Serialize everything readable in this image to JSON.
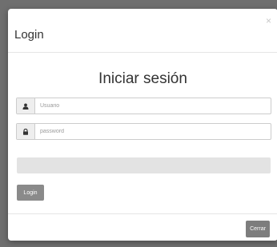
{
  "modal": {
    "title": "Login",
    "close_glyph": "×",
    "heading": "Iniciar sesión"
  },
  "form": {
    "username": {
      "placeholder": "Usuario",
      "value": "",
      "icon": "user-icon"
    },
    "password": {
      "placeholder": "password",
      "value": "",
      "icon": "lock-icon"
    },
    "progress": {
      "fraction": 0
    },
    "login_label": "Login"
  },
  "footer": {
    "close_label": "Cerrar"
  },
  "colors": {
    "backdrop": "#6f6f6f",
    "button": "#8a8a8a",
    "progress_track": "#e3e3e3"
  }
}
